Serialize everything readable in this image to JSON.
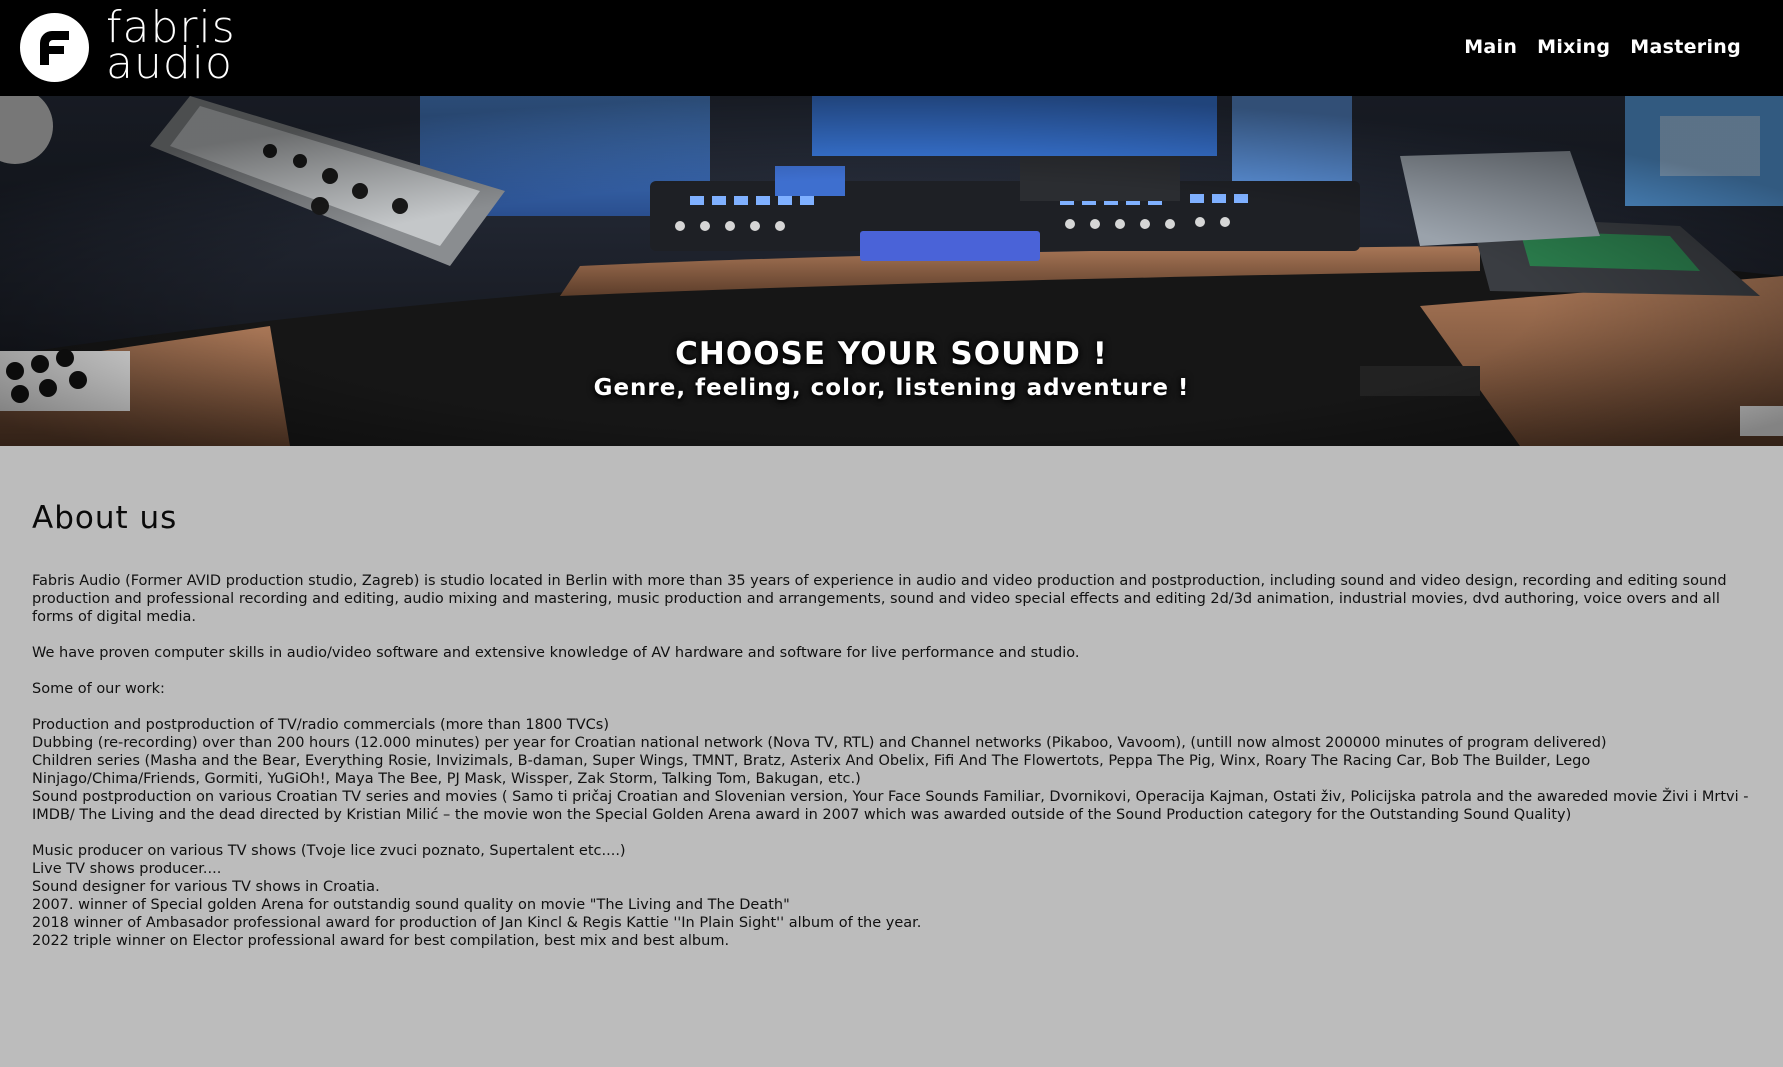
{
  "header": {
    "logo_line1": "fabris",
    "logo_line2": "audio",
    "logo_mark_icon": "fabris-f-logo-icon",
    "nav": [
      {
        "label": "Main"
      },
      {
        "label": "Mixing"
      },
      {
        "label": "Mastering"
      }
    ]
  },
  "hero": {
    "title": "CHOOSE YOUR SOUND !",
    "subtitle": "Genre, feeling, color, listening adventure !"
  },
  "about": {
    "heading": "About us",
    "intro": "Fabris Audio (Former AVID production studio, Zagreb) is studio located in Berlin with more than 35 years of experience in audio and video production and postproduction, including sound and video design, recording and editing sound production and professional recording and editing, audio mixing and mastering, music production and arrangements, sound and video special effects and editing 2d/3d animation, industrial movies, dvd authoring, voice overs and all forms of digital media.",
    "skills": "We have proven computer skills in audio/video software and extensive knowledge of AV hardware and software for live performance and studio.",
    "work_heading": "Some of our work:",
    "work_items": [
      "Production and postproduction of TV/radio commercials (more than 1800 TVCs)",
      "Dubbing (re-recording) over than 200 hours (12.000 minutes) per year for Croatian national network (Nova TV, RTL) and Channel networks (Pikaboo, Vavoom), (untill now almost 200000 minutes of program delivered)",
      "Children series (Masha and the Bear, Everything Rosie, Invizimals, B-daman, Super Wings, TMNT, Bratz, Asterix And Obelix, Fifi And The Flowertots, Peppa The Pig, Winx, Roary The Racing Car, Bob The Builder, Lego Ninjago/Chima/Friends, Gormiti, YuGiOh!, Maya The Bee, PJ Mask, Wissper, Zak Storm, Talking Tom, Bakugan, etc.)",
      "Sound postproduction on various Croatian TV series and movies ( Samo ti pričaj Croatian and Slovenian version, Your Face Sounds Familiar, Dvornikovi, Operacija Kajman, Ostati živ, Policijska patrola and the awareded movie Živi i Mrtvi - IMDB/ The Living and the dead directed by Kristian Milić – the movie won the Special Golden Arena award in 2007 which was awarded outside of the Sound Production category for the Outstanding Sound Quality)"
    ],
    "more_items": [
      "Music producer on various TV shows (Tvoje lice zvuci poznato, Supertalent etc....)",
      "Live TV shows producer....",
      "Sound designer for various TV shows in Croatia.",
      "2007. winner of Special golden Arena for outstandig sound quality on movie \"The Living and The Death\"",
      "2018 winner of Ambasador professional award for production of Jan Kincl & Regis Kattie ''In Plain Sight'' album of the year.",
      "2022 triple winner on Elector professional award for best compilation, best mix and best album."
    ]
  }
}
